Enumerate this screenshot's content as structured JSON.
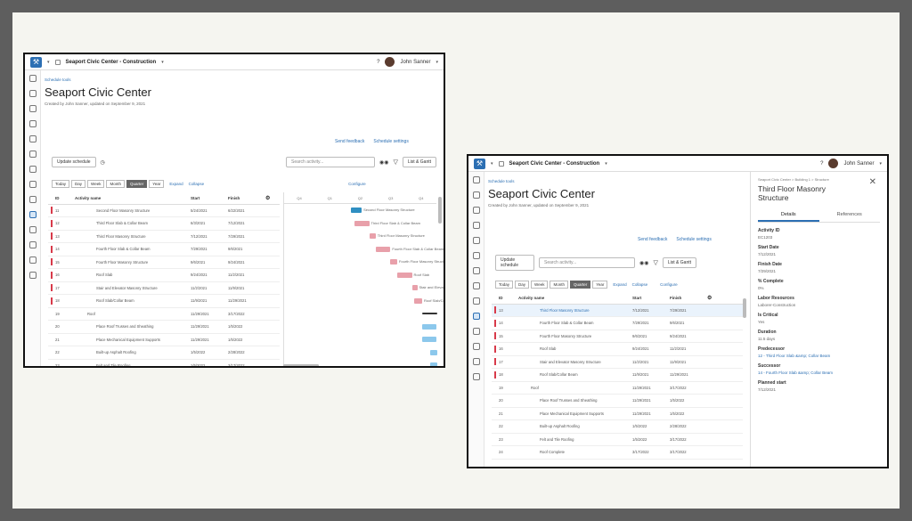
{
  "app": {
    "project": "Seaport Civic Center - Construction",
    "user": "John Sanner"
  },
  "page": {
    "breadcrumb": "Schedule tools",
    "title": "Seaport Civic Center",
    "subtitle": "Created by John Sanner, updated on September 9, 2021",
    "send_feedback": "Send feedback",
    "schedule_settings": "Schedule settings",
    "update_schedule": "Update schedule",
    "search_placeholder": "Search activity...",
    "view_mode": "List & Gantt"
  },
  "zoom": {
    "today": "Today",
    "day": "Day",
    "week": "Week",
    "month": "Month",
    "quarter": "Quarter",
    "year": "Year",
    "expand": "Expand",
    "collapse": "Collapse",
    "configure": "Configure"
  },
  "columns": {
    "id": "ID",
    "name": "Activity name",
    "start": "Start",
    "finish": "Finish"
  },
  "gantt_quarters": [
    "Q4",
    "Q1",
    "Q2",
    "Q3",
    "Q4"
  ],
  "left_rows": [
    {
      "id": "11",
      "name": "Second Floor Masonry Structure",
      "start": "5/24/2021",
      "finish": "6/22/2021"
    },
    {
      "id": "12",
      "name": "Third Floor Slab & Collar Beam",
      "start": "6/3/2021",
      "finish": "7/12/2021"
    },
    {
      "id": "13",
      "name": "Third Floor Masonry Structure",
      "start": "7/12/2021",
      "finish": "7/29/2021"
    },
    {
      "id": "14",
      "name": "Fourth Floor Slab & Collar Beam",
      "start": "7/29/2021",
      "finish": "9/6/2021"
    },
    {
      "id": "15",
      "name": "Fourth Floor Masonry Structure",
      "start": "9/6/2021",
      "finish": "9/24/2021"
    },
    {
      "id": "16",
      "name": "Roof Slab",
      "start": "9/24/2021",
      "finish": "11/2/2021"
    },
    {
      "id": "17",
      "name": "Stair and Elevator Masonry Structure",
      "start": "11/2/2021",
      "finish": "11/9/2021"
    },
    {
      "id": "18",
      "name": "Roof Slab/Collar Beam",
      "start": "11/9/2021",
      "finish": "11/29/2021"
    },
    {
      "id": "19",
      "name": "Roof",
      "start": "11/29/2021",
      "finish": "3/17/2022"
    },
    {
      "id": "20",
      "name": "Place Roof Trusses and Sheathing",
      "start": "11/29/2021",
      "finish": "1/5/2022"
    },
    {
      "id": "21",
      "name": "Place Mechanical Equipment Supports",
      "start": "11/29/2021",
      "finish": "1/5/2022"
    },
    {
      "id": "22",
      "name": "Built-up Asphalt Roofing",
      "start": "1/5/2022",
      "finish": "2/28/2022"
    },
    {
      "id": "23",
      "name": "Felt and Tile Roofing",
      "start": "1/5/2022",
      "finish": "3/17/2022"
    }
  ],
  "gantt_labels": [
    "Second Floor Masonry Structure",
    "Third Floor Slab & Collar Beam",
    "Third Floor Masonry Structure",
    "Fourth Floor Slab & Collar Beam",
    "Fourth Floor Masonry Structure",
    "Roof Slab",
    "Stair and Elevator Masonry Structure",
    "Roof Slab/Collar Beam"
  ],
  "right_rows": [
    {
      "id": "13",
      "name": "Third Floor Masonry Structure",
      "start": "7/12/2021",
      "finish": "7/29/2021"
    },
    {
      "id": "14",
      "name": "Fourth Floor Slab & Collar Beam",
      "start": "7/29/2021",
      "finish": "9/6/2021"
    },
    {
      "id": "15",
      "name": "Fourth Floor Masonry Structure",
      "start": "9/6/2021",
      "finish": "9/24/2021"
    },
    {
      "id": "16",
      "name": "Roof Slab",
      "start": "9/24/2021",
      "finish": "11/2/2021"
    },
    {
      "id": "17",
      "name": "Stair and Elevator Masonry Structure",
      "start": "11/2/2021",
      "finish": "11/9/2021"
    },
    {
      "id": "18",
      "name": "Roof Slab/Collar Beam",
      "start": "11/9/2021",
      "finish": "11/29/2021"
    },
    {
      "id": "19",
      "name": "Roof",
      "start": "11/29/2021",
      "finish": "3/17/2022"
    },
    {
      "id": "20",
      "name": "Place Roof Trusses and Sheathing",
      "start": "11/29/2021",
      "finish": "1/5/2022"
    },
    {
      "id": "21",
      "name": "Place Mechanical Equipment Supports",
      "start": "11/29/2021",
      "finish": "1/5/2022"
    },
    {
      "id": "22",
      "name": "Built-up Asphalt Roofing",
      "start": "1/5/2022",
      "finish": "2/28/2022"
    },
    {
      "id": "23",
      "name": "Felt and Tile Roofing",
      "start": "1/5/2022",
      "finish": "3/17/2022"
    },
    {
      "id": "24",
      "name": "Roof Complete",
      "start": "3/17/2022",
      "finish": "3/17/2022"
    }
  ],
  "panel": {
    "breadcrumb": "Seaport Civic Center > Building 1 > Structure",
    "title": "Third Floor Masonry Structure",
    "tab_details": "Details",
    "tab_references": "References",
    "fields": [
      {
        "label": "Activity ID",
        "value": "EC1203"
      },
      {
        "label": "Start Date",
        "value": "7/12/2021"
      },
      {
        "label": "Finish Date",
        "value": "7/29/2021"
      },
      {
        "label": "% Complete",
        "value": "0%"
      },
      {
        "label": "Labor Resources",
        "value": "Laborer-Construction"
      },
      {
        "label": "Is Critical",
        "value": "Yes"
      },
      {
        "label": "Duration",
        "value": "11.5 days"
      },
      {
        "label": "Predecessor",
        "value": "12 - Third Floor Slab &amp; Collar Beam"
      },
      {
        "label": "Successor",
        "value": "14 - Fourth Floor Slab &amp; Collar Beam"
      },
      {
        "label": "Planned start",
        "value": "7/12/2021"
      }
    ]
  },
  "colors": {
    "critical": "#d83a4a",
    "bar_pink": "#e8a0aa",
    "bar_blue": "#8cc8ec",
    "accent": "#2c6fb3"
  }
}
